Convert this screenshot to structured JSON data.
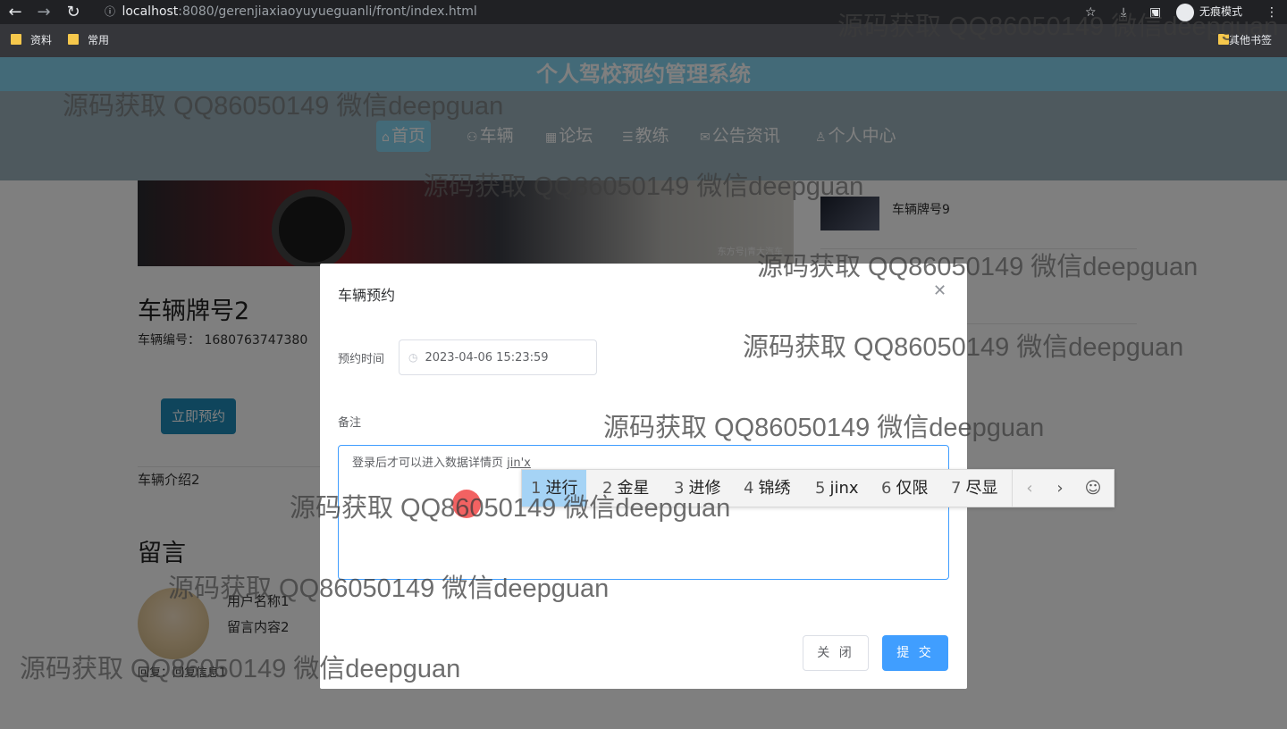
{
  "browser": {
    "url_host": "localhost",
    "url_path": ":8080/gerenjiaxiaoyuyueguanli/front/index.html",
    "incognito_label": "无痕模式",
    "bookmarks": [
      "资料",
      "常用"
    ],
    "other_bookmarks": "其他书签",
    "icons": [
      "back-arrow-icon",
      "forward-arrow-icon",
      "reload-icon",
      "info-icon",
      "star-icon",
      "download-icon",
      "sidebar-icon",
      "menu-dots-icon"
    ]
  },
  "site": {
    "title": "个人驾校预约管理系统",
    "nav": [
      {
        "label": "首页",
        "icon": "home-icon",
        "active": true
      },
      {
        "label": "车辆",
        "icon": "car-icon",
        "active": false
      },
      {
        "label": "论坛",
        "icon": "forum-icon",
        "active": false
      },
      {
        "label": "教练",
        "icon": "book-icon",
        "active": false
      },
      {
        "label": "公告资讯",
        "icon": "mail-icon",
        "active": false
      },
      {
        "label": "个人中心",
        "icon": "user-icon",
        "active": false
      }
    ]
  },
  "content": {
    "side_item": "车辆牌号9",
    "image_watermark": "东方号|青大汽车",
    "car_title": "车辆牌号2",
    "car_number_label": "车辆编号：",
    "car_number_value": "1680763747380",
    "book_button": "立即预约",
    "car_intro": "车辆介绍2",
    "messages_title": "留言",
    "user_name": "用户名称1",
    "message_content": "留言内容2",
    "reply": "回复：回复信息1"
  },
  "dialog": {
    "title": "车辆预约",
    "time_label": "预约时间",
    "time_value": "2023-04-06 15:23:59",
    "remark_label": "备注",
    "remark_text": "登录后才可以进入数据详情页 ",
    "remark_composing": "jin'x",
    "close_button": "关 闭",
    "submit_button": "提 交"
  },
  "ime": {
    "candidates": [
      {
        "num": "1",
        "text": "进行"
      },
      {
        "num": "2",
        "text": "金星"
      },
      {
        "num": "3",
        "text": "进修"
      },
      {
        "num": "4",
        "text": "锦绣"
      },
      {
        "num": "5",
        "text": "jinx"
      },
      {
        "num": "6",
        "text": "仅限"
      },
      {
        "num": "7",
        "text": "尽显"
      }
    ],
    "selected_index": 0
  },
  "watermark": "源码获取 QQ86050149 微信deepguan",
  "colors": {
    "banner": "#87d5f1",
    "primary": "#409eff",
    "book_button": "#1f8bb8"
  }
}
